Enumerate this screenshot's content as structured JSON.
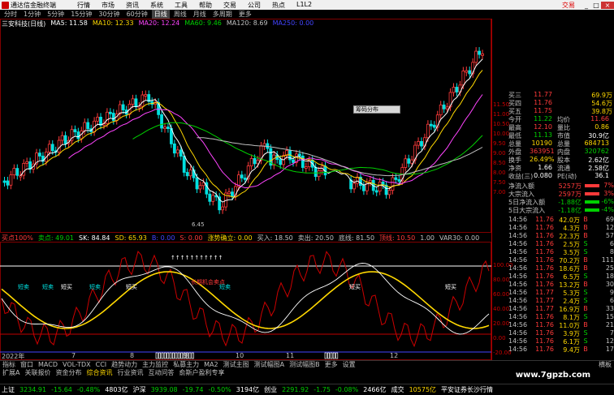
{
  "titlebar": {
    "app_name": "通达信金融终端",
    "menus": [
      "行情",
      "市场",
      "资讯",
      "系统",
      "工具",
      "帮助",
      "交易",
      "公司",
      "热点",
      "L1L2"
    ],
    "right_label": "交易",
    "btn_min": "_",
    "btn_max": "□",
    "btn_close": "×"
  },
  "periodbar": {
    "items": [
      "分时",
      "1分钟",
      "5分钟",
      "15分钟",
      "30分钟",
      "60分钟",
      "日线",
      "周线",
      "月线",
      "多周期",
      "更多"
    ],
    "active": "日线"
  },
  "stock": {
    "name": "三安科技(日线)",
    "ma_labels": [
      {
        "text": "MA5: 11.58",
        "color": "#ffffff"
      },
      {
        "text": "MA10: 12.33",
        "color": "#ffd800"
      },
      {
        "text": "MA20: 12.24",
        "color": "#ff44ff"
      },
      {
        "text": "MA60: 9.46",
        "color": "#00d000"
      },
      {
        "text": "MA120: 8.69",
        "color": "#c0c0c0"
      },
      {
        "text": "MA250: 0.00",
        "color": "#4444ff"
      }
    ],
    "low_label": "6.45"
  },
  "popup": {
    "label": "筹码分布"
  },
  "subbar": {
    "items": [
      {
        "text": "买点100%",
        "color": "#ff3a3a"
      },
      {
        "text": "卖点: 49.01",
        "color": "#00d000"
      },
      {
        "text": "SK: 84.84",
        "color": "#ffffff"
      },
      {
        "text": "SD: 65.93",
        "color": "#ffd800"
      },
      {
        "text": "B: 0.00",
        "color": "#4444ff"
      },
      {
        "text": "S: 0.00",
        "color": "#ff3a3a"
      },
      {
        "text": "涨势确立: 0.00",
        "color": "#ffd800"
      },
      {
        "text": "买入: 18.50",
        "color": "#c0c0c0"
      },
      {
        "text": "卖出: 20.50",
        "color": "#c0c0c0"
      },
      {
        "text": "底线: 81.50",
        "color": "#c0c0c0"
      },
      {
        "text": "顶线: 10.50",
        "color": "#ff3a3a"
      },
      {
        "text": "1.00",
        "color": "#c0c0c0"
      },
      {
        "text": "VAR30: 0.00",
        "color": "#c0c0c0"
      }
    ]
  },
  "indicator": {
    "labels_buy": [
      "短买",
      "短买",
      "短买",
      "短买"
    ],
    "labels_sell": [
      "短卖",
      "短卖",
      "短卖",
      "短卖"
    ],
    "trend_label": "长期机会卖点",
    "arrows_text": "↑↑↑↑↑↑↑↑↑↑↑",
    "flag_sell": "预警",
    "flag_buy": "抄底"
  },
  "timeaxis": {
    "year": "2022年",
    "months": [
      "7",
      "8",
      "9",
      "10",
      "11",
      "12"
    ]
  },
  "tabbar": {
    "items": [
      "指标",
      "窗口",
      "MACD",
      "VOL-TDX",
      "CCI",
      "趋势动力",
      "主力监控",
      "私募主力",
      "MA2",
      "测试主图",
      "测试幅图A",
      "测试幅图B",
      "更多",
      "设置"
    ],
    "right": "横板"
  },
  "tabbar2": {
    "items": [
      "扩展A",
      "关联报价",
      "资金分布",
      "综合资讯",
      "行业资讯",
      "互动问答",
      "俞斯户盈利专享"
    ]
  },
  "watermark": "www.7gpzb.com",
  "statusbar": [
    {
      "text": "上证",
      "cls": "w"
    },
    {
      "text": "3234.91",
      "cls": "down"
    },
    {
      "text": "-15.64",
      "cls": "down"
    },
    {
      "text": "-0.48%",
      "cls": "down"
    },
    {
      "text": "4803亿",
      "cls": "w"
    },
    {
      "text": "沪深",
      "cls": "w"
    },
    {
      "text": "3939.08",
      "cls": "down"
    },
    {
      "text": "-19.74",
      "cls": "down"
    },
    {
      "text": "-0.50%",
      "cls": "down"
    },
    {
      "text": "3194亿",
      "cls": "w"
    },
    {
      "text": "创业",
      "cls": "w"
    },
    {
      "text": "2291.92",
      "cls": "down"
    },
    {
      "text": "-1.75",
      "cls": "down"
    },
    {
      "text": "-0.08%",
      "cls": "down"
    },
    {
      "text": "2466亿",
      "cls": "w"
    },
    {
      "text": "成交",
      "cls": "w"
    },
    {
      "text": "10575亿",
      "cls": "y"
    },
    {
      "text": "平安证券长沙行情",
      "cls": "w"
    }
  ],
  "yaxis_main": [
    "11.50",
    "11.00",
    "10.50",
    "10.00",
    "9.50",
    "9.00",
    "8.50",
    "8.00",
    "7.50",
    "7.00"
  ],
  "yaxis_ind": [
    "100.00",
    "80.00",
    "60.00",
    "40.00",
    "20.00",
    "0.00",
    "-20.00"
  ],
  "panel": {
    "quotes": [
      {
        "label": "买三",
        "price": "11.77",
        "vol": "69.9万",
        "pcls": "red"
      },
      {
        "label": "买四",
        "price": "11.76",
        "vol": "54.6万",
        "pcls": "red"
      },
      {
        "label": "买五",
        "price": "11.75",
        "vol": "39.8万",
        "pcls": "red"
      }
    ],
    "stats": [
      {
        "l1": "今开",
        "v1": "11.22",
        "c1": "grn",
        "l2": "均价",
        "v2": "11.66",
        "c2": "red"
      },
      {
        "l1": "最高",
        "v1": "12.10",
        "c1": "red",
        "l2": "量比",
        "v2": "0.86",
        "c2": "yel"
      },
      {
        "l1": "最低",
        "v1": "11.13",
        "c1": "grn",
        "l2": "市值",
        "v2": "30.9亿",
        "c2": "wht"
      },
      {
        "l1": "总量",
        "v1": "10190",
        "c1": "yel",
        "l2": "总量",
        "v2": "684713",
        "c2": "yel"
      },
      {
        "l1": "外盘",
        "v1": "363951",
        "c1": "red",
        "l2": "内盘",
        "v2": "320762",
        "c2": "grn"
      },
      {
        "l1": "换手",
        "v1": "26.49%",
        "c1": "yel",
        "l2": "股本",
        "v2": "2.62亿",
        "c2": "wht"
      },
      {
        "l1": "净资",
        "v1": "1.66",
        "c1": "wht",
        "l2": "流通",
        "v2": "2.58亿",
        "c2": "wht"
      },
      {
        "l1": "收益(三)",
        "v1": "0.080",
        "c1": "wht",
        "l2": "PE(动)",
        "v2": "36.1",
        "c2": "wht"
      }
    ],
    "flows": [
      {
        "label": "净流入额",
        "value": "5257万",
        "pct": "7%",
        "cls": "red"
      },
      {
        "label": "大宗流入",
        "value": "2597万",
        "pct": "3%",
        "cls": "red"
      },
      {
        "label": "5日净流入额",
        "value": "-1.88亿",
        "pct": "-6%",
        "cls": "grn"
      },
      {
        "label": "5日大宗流入",
        "value": "-1.18亿",
        "pct": "-4%",
        "cls": "grn"
      }
    ],
    "ticks": [
      {
        "t": "14:56",
        "p": "11.76",
        "v": "42.0万",
        "d": "B",
        "dc": "red",
        "n": "69"
      },
      {
        "t": "14:56",
        "p": "11.76",
        "v": "4.3万",
        "d": "B",
        "dc": "red",
        "n": "12"
      },
      {
        "t": "14:56",
        "p": "11.76",
        "v": "22.3万",
        "d": "B",
        "dc": "red",
        "n": "57"
      },
      {
        "t": "14:56",
        "p": "11.76",
        "v": "2.5万",
        "d": "S",
        "dc": "grn",
        "n": "6"
      },
      {
        "t": "14:56",
        "p": "11.76",
        "v": "3.5万",
        "d": "S",
        "dc": "grn",
        "n": "8"
      },
      {
        "t": "14:56",
        "p": "11.76",
        "v": "70.2万",
        "d": "B",
        "dc": "red",
        "n": "111"
      },
      {
        "t": "14:56",
        "p": "11.76",
        "v": "18.6万",
        "d": "B",
        "dc": "red",
        "n": "25"
      },
      {
        "t": "14:56",
        "p": "11.76",
        "v": "6.5万",
        "d": "S",
        "dc": "grn",
        "n": "18"
      },
      {
        "t": "14:56",
        "p": "11.76",
        "v": "13.2万",
        "d": "B",
        "dc": "red",
        "n": "30"
      },
      {
        "t": "14:56",
        "p": "11.77",
        "v": "5.3万",
        "d": "S",
        "dc": "grn",
        "n": "9"
      },
      {
        "t": "14:56",
        "p": "11.77",
        "v": "2.4万",
        "d": "S",
        "dc": "grn",
        "n": "6"
      },
      {
        "t": "14:56",
        "p": "11.77",
        "v": "16.9万",
        "d": "B",
        "dc": "red",
        "n": "33"
      },
      {
        "t": "14:56",
        "p": "11.76",
        "v": "8.1万",
        "d": "S",
        "dc": "grn",
        "n": "15"
      },
      {
        "t": "14:56",
        "p": "11.76",
        "v": "11.0万",
        "d": "B",
        "dc": "red",
        "n": "21"
      },
      {
        "t": "14:56",
        "p": "11.76",
        "v": "3.9万",
        "d": "S",
        "dc": "grn",
        "n": "7"
      },
      {
        "t": "14:56",
        "p": "11.76",
        "v": "6.1万",
        "d": "S",
        "dc": "grn",
        "n": "12"
      },
      {
        "t": "14:56",
        "p": "11.76",
        "v": "9.4万",
        "d": "B",
        "dc": "red",
        "n": "17"
      }
    ]
  }
}
